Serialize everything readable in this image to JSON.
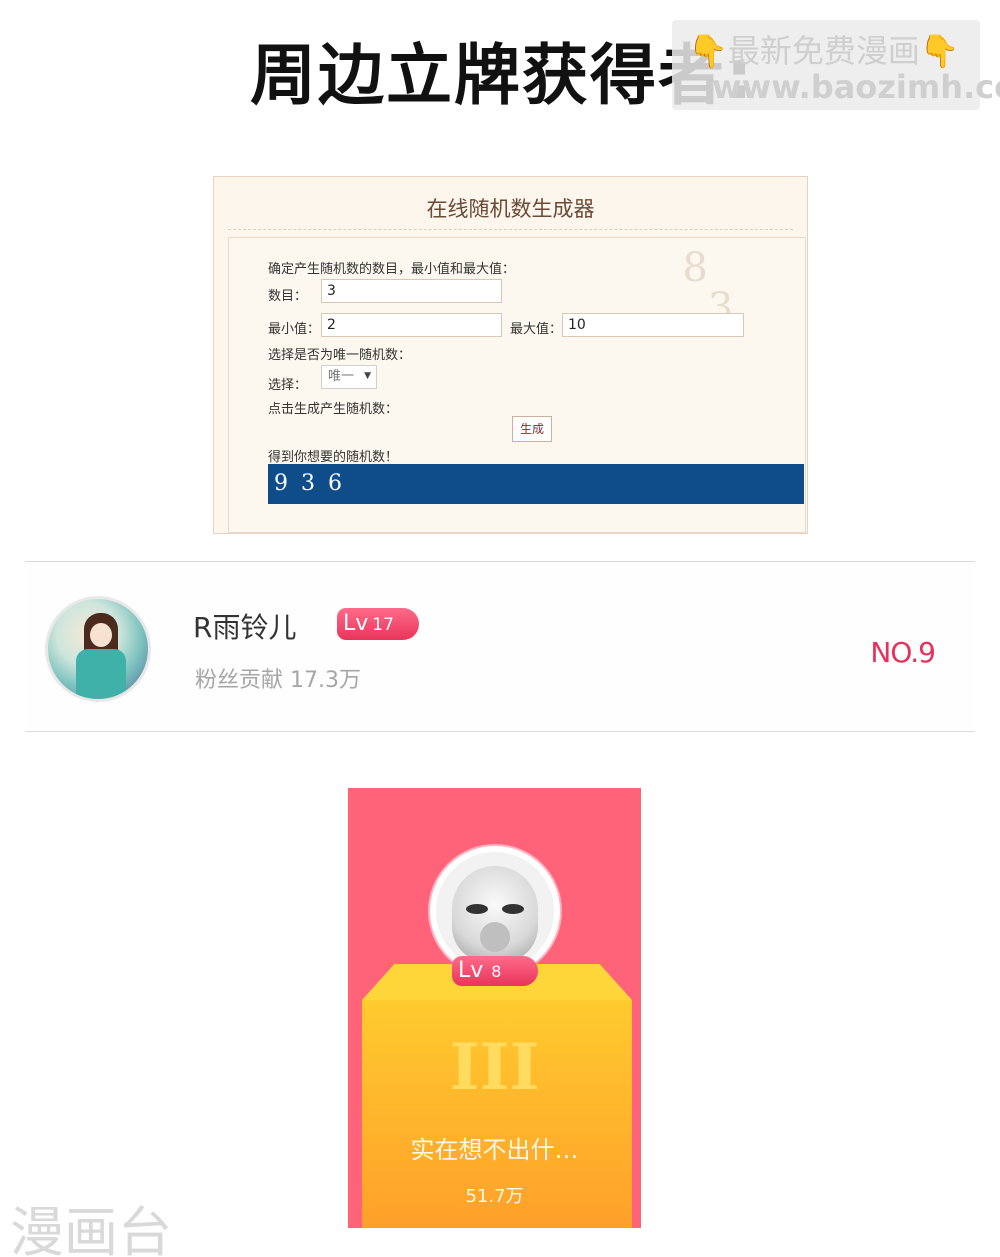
{
  "header": {
    "title": "周边立牌获得者:",
    "watermark_line1": "最新免费漫画",
    "watermark_hand": "👇",
    "watermark_line2": "www.baozimh.com"
  },
  "generator": {
    "title": "在线随机数生成器",
    "instruction": "确定产生随机数的数目，最小值和最大值：",
    "count_label": "数目：",
    "count_value": "3",
    "min_label": "最小值：",
    "min_value": "2",
    "max_label": "最大值：",
    "max_value": "10",
    "unique_prompt": "选择是否为唯一随机数：",
    "select_label": "选择：",
    "select_value": "唯一",
    "generate_prompt": "点击生成产生随机数：",
    "generate_button": "生成",
    "result_label": "得到你想要的随机数！",
    "result_value": "9 3 6"
  },
  "fan": {
    "name": "R雨铃儿",
    "level_prefix": "Lv",
    "level": "17",
    "contribution": "粉丝贡献 17.3万",
    "rank": "NO.9"
  },
  "card": {
    "level_prefix": "Lv",
    "level": "8",
    "rank_numeral": "III",
    "name": "实在想不出什…",
    "score": "51.7万"
  },
  "footer": {
    "watermark": "漫画台"
  }
}
